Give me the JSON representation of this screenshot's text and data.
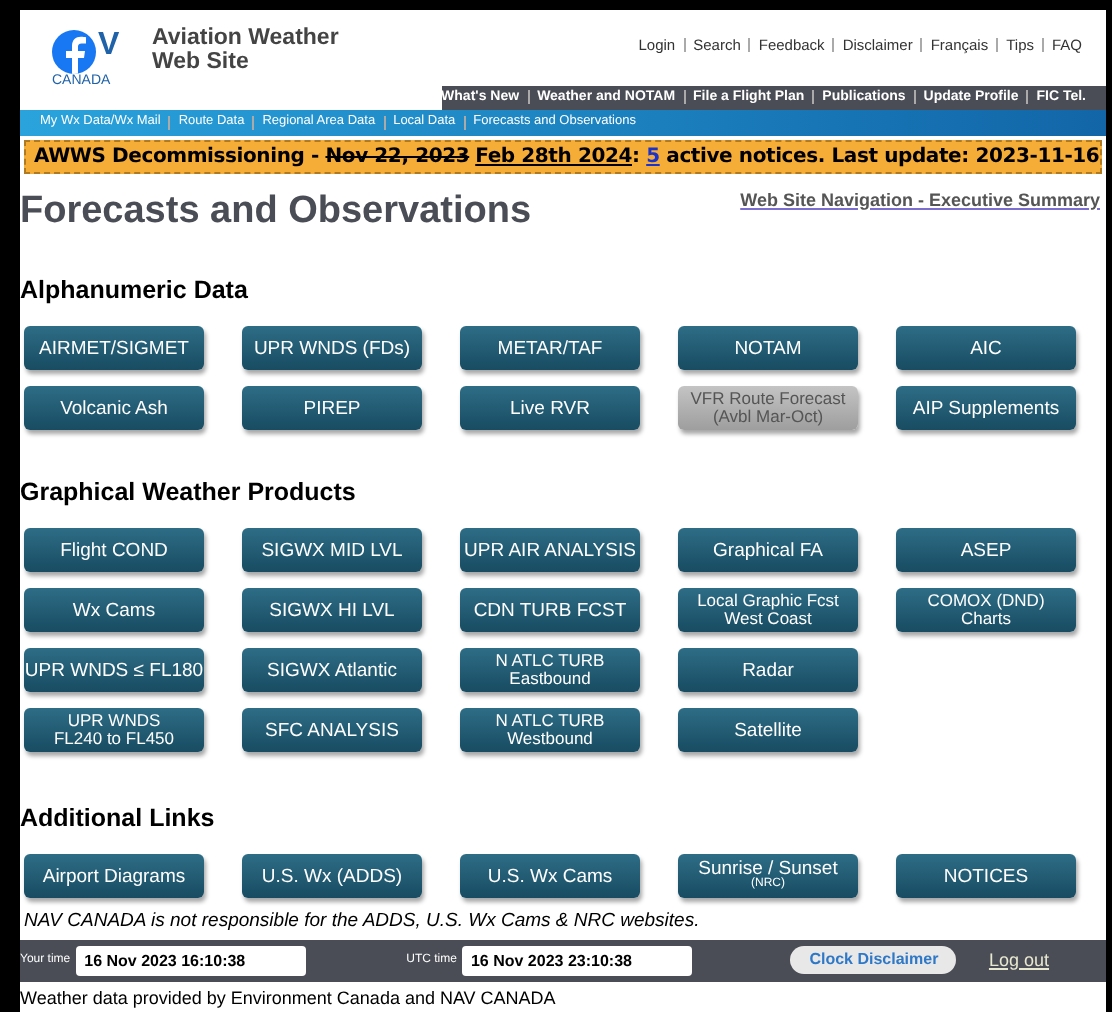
{
  "header": {
    "logo": {
      "letters": "V",
      "name": "CANADA"
    },
    "site_title": [
      "Aviation Weather",
      "Web Site"
    ],
    "top_links": [
      "Login",
      "Search",
      "Feedback",
      "Disclaimer",
      "Français",
      "Tips",
      "FAQ"
    ],
    "main_nav": [
      "What's New",
      "Weather and NOTAM",
      "File a Flight Plan",
      "Publications",
      "Update Profile",
      "FIC Tel."
    ],
    "sub_nav": [
      "My Wx Data/Wx Mail",
      "Route Data",
      "Regional Area Data",
      "Local Data",
      "Forecasts and Observations"
    ]
  },
  "banner": [
    {
      "kind": "text",
      "text": "AWWS Decommissioning - "
    },
    {
      "kind": "strike",
      "text": "Nov 22, 2023"
    },
    {
      "kind": "underline",
      "text": "Feb 28th 2024"
    },
    {
      "kind": "text",
      "text": ": "
    },
    {
      "kind": "link",
      "text": "5"
    },
    {
      "kind": "text",
      "text": " active notices. Last update: 2023-11-16"
    }
  ],
  "page_title": "Forecasts and Observations",
  "exec_link": "Web Site Navigation - Executive Summary",
  "sections": [
    {
      "heading": "Alphanumeric Data",
      "rows": [
        [
          {
            "lines": [
              "AIRMET/SIGMET"
            ],
            "disabled": false
          },
          {
            "lines": [
              "UPR WNDS (FDs)"
            ],
            "disabled": false
          },
          {
            "lines": [
              "METAR/TAF"
            ],
            "disabled": false
          },
          {
            "lines": [
              "NOTAM"
            ],
            "disabled": false
          },
          {
            "lines": [
              "AIC"
            ],
            "disabled": false
          }
        ],
        [
          {
            "lines": [
              "Volcanic Ash"
            ],
            "disabled": false
          },
          {
            "lines": [
              "PIREP"
            ],
            "disabled": false
          },
          {
            "lines": [
              "Live RVR"
            ],
            "disabled": false
          },
          {
            "lines": [
              "VFR Route Forecast",
              "(Avbl Mar-Oct)"
            ],
            "disabled": true
          },
          {
            "lines": [
              "AIP Supplements"
            ],
            "disabled": false
          }
        ]
      ]
    },
    {
      "heading": "Graphical Weather Products",
      "rows": [
        [
          {
            "lines": [
              "Flight COND"
            ],
            "disabled": false
          },
          {
            "lines": [
              "SIGWX MID LVL"
            ],
            "disabled": false
          },
          {
            "lines": [
              "UPR AIR ANALYSIS"
            ],
            "disabled": false
          },
          {
            "lines": [
              "Graphical FA"
            ],
            "disabled": false
          },
          {
            "lines": [
              "ASEP"
            ],
            "disabled": false
          }
        ],
        [
          {
            "lines": [
              "Wx Cams"
            ],
            "disabled": false
          },
          {
            "lines": [
              "SIGWX HI LVL"
            ],
            "disabled": false
          },
          {
            "lines": [
              "CDN TURB FCST"
            ],
            "disabled": false
          },
          {
            "lines": [
              "Local Graphic Fcst",
              "West Coast"
            ],
            "disabled": false
          },
          {
            "lines": [
              "COMOX (DND)",
              "Charts"
            ],
            "disabled": false
          }
        ],
        [
          {
            "lines": [
              "UPR WNDS ≤ FL180"
            ],
            "disabled": false
          },
          {
            "lines": [
              "SIGWX Atlantic"
            ],
            "disabled": false
          },
          {
            "lines": [
              "N ATLC TURB",
              "Eastbound"
            ],
            "disabled": false
          },
          {
            "lines": [
              "Radar"
            ],
            "disabled": false
          }
        ],
        [
          {
            "lines": [
              "UPR WNDS",
              "FL240 to FL450"
            ],
            "disabled": false
          },
          {
            "lines": [
              "SFC ANALYSIS"
            ],
            "disabled": false
          },
          {
            "lines": [
              "N ATLC TURB",
              "Westbound"
            ],
            "disabled": false
          },
          {
            "lines": [
              "Satellite"
            ],
            "disabled": false
          }
        ]
      ]
    },
    {
      "heading": "Additional Links",
      "rows": [
        [
          {
            "lines": [
              "Airport Diagrams"
            ],
            "disabled": false
          },
          {
            "lines": [
              "U.S. Wx (ADDS)"
            ],
            "disabled": false
          },
          {
            "lines": [
              "U.S. Wx Cams"
            ],
            "disabled": false
          },
          {
            "lines": [
              "Sunrise / Sunset"
            ],
            "note": "(NRC)",
            "disabled": false
          },
          {
            "lines": [
              "NOTICES"
            ],
            "disabled": false
          }
        ]
      ]
    }
  ],
  "disclaimer": "NAV CANADA is not responsible for the ADDS, U.S. Wx Cams & NRC websites.",
  "clock": {
    "local_label": "Your time",
    "local_value": "16 Nov 2023 16:10:38",
    "utc_label": "UTC time",
    "utc_value": "16 Nov 2023 23:10:38",
    "disclaimer_button": "Clock Disclaimer",
    "logout": "Log out"
  },
  "credit": "Weather data provided by Environment Canada and NAV CANADA"
}
